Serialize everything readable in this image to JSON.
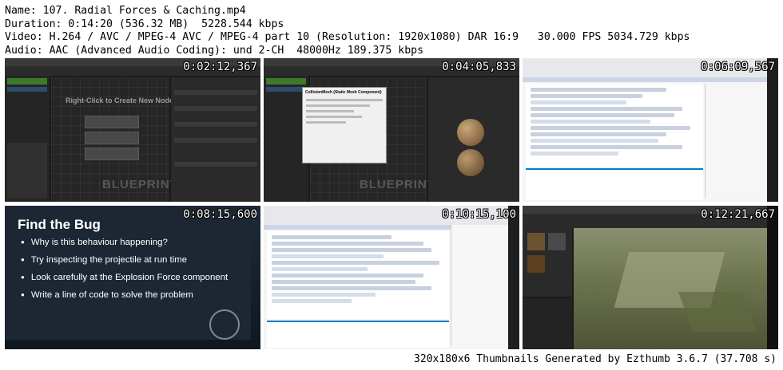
{
  "header": {
    "name": "Name: 107. Radial Forces & Caching.mp4",
    "duration": "Duration: 0:14:20 (536.32 MB)  5228.544 kbps",
    "video": "Video: H.264 / AVC / MPEG-4 AVC / MPEG-4 part 10 (Resolution: 1920x1080) DAR 16:9   30.000 FPS 5034.729 kbps",
    "audio": "Audio: AAC (Advanced Audio Coding): und 2-CH  48000Hz 189.375 kbps"
  },
  "thumbnails": [
    {
      "timestamp": "0:02:12,367",
      "label": "Right-Click to Create New Nodes.",
      "watermark": "BLUEPRINT"
    },
    {
      "timestamp": "0:04:05,833",
      "tooltip_title": "CollisionMesh (Static Mesh Component)",
      "watermark": "BLUEPRINT"
    },
    {
      "timestamp": "0:06:09,567"
    },
    {
      "timestamp": "0:08:15,600",
      "title": "Find the Bug",
      "bullets": [
        "Why is this behaviour happening?",
        "Try inspecting the projectile at run time",
        "Look carefully at the Explosion Force component",
        "Write a line of code to solve the problem"
      ]
    },
    {
      "timestamp": "0:10:15,100"
    },
    {
      "timestamp": "0:12:21,667"
    }
  ],
  "footer": "320x180x6 Thumbnails Generated by Ezthumb 3.6.7 (37.708 s)",
  "colors": {
    "background": "#ffffff",
    "text": "#000000",
    "ue_dark": "#1a1a1a",
    "vs_dark": "#2d2d30",
    "vs_light": "#f5f5f5"
  }
}
